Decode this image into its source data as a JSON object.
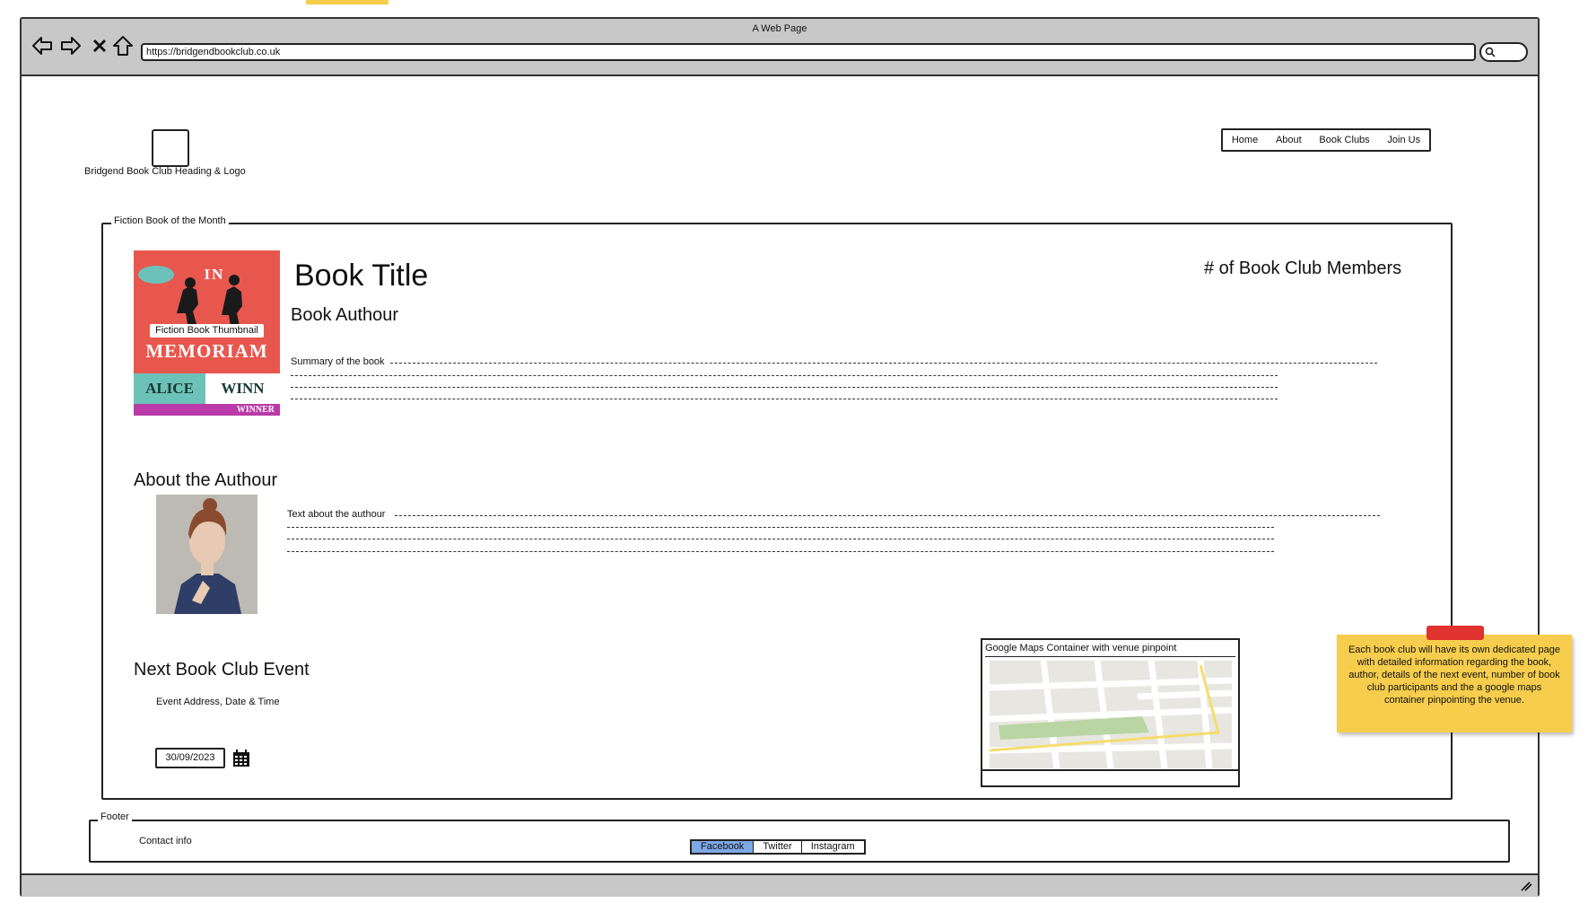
{
  "browser": {
    "window_title": "A Web Page",
    "url": "https://bridgendbookclub.co.uk"
  },
  "header": {
    "logo_label": "Bridgend Book Club Heading & Logo",
    "nav": [
      "Home",
      "About",
      "Book Clubs",
      "Join Us"
    ]
  },
  "fiction_section": {
    "legend": "Fiction Book of the Month",
    "book_title": "Book Title",
    "book_author": "Book Authour",
    "members_count_label": "# of Book Club Members",
    "summary_label": "Summary of the book",
    "thumbnail": {
      "label": "Fiction Book Thumbnail",
      "cover_word_1": "IN",
      "cover_word_2": "MEMORIAM",
      "author_first": "ALICE",
      "author_last": "WINN",
      "badge": "WINNER"
    }
  },
  "about_author": {
    "heading": "About the Authour",
    "text_label": "Text about the authour"
  },
  "event": {
    "heading": "Next Book Club Event",
    "details": "Event Address, Date & Time",
    "date_value": "30/09/2023"
  },
  "map": {
    "label": "Google Maps Container with venue pinpoint"
  },
  "sticky_note": {
    "text": "Each book club will have its own dedicated page with detailed information regarding the book, author, details of the next event, number of book club participants and the a google maps container pinpointing the venue."
  },
  "footer": {
    "legend": "Footer",
    "contact": "Contact info",
    "links": [
      "Facebook",
      "Twitter",
      "Instagram"
    ]
  },
  "colors": {
    "sticky": "#f6cd4c",
    "tape": "#e0322f",
    "facebook_highlight": "#7fa8e6",
    "cover_red": "#e8574e",
    "cover_teal": "#6cc2b8"
  }
}
